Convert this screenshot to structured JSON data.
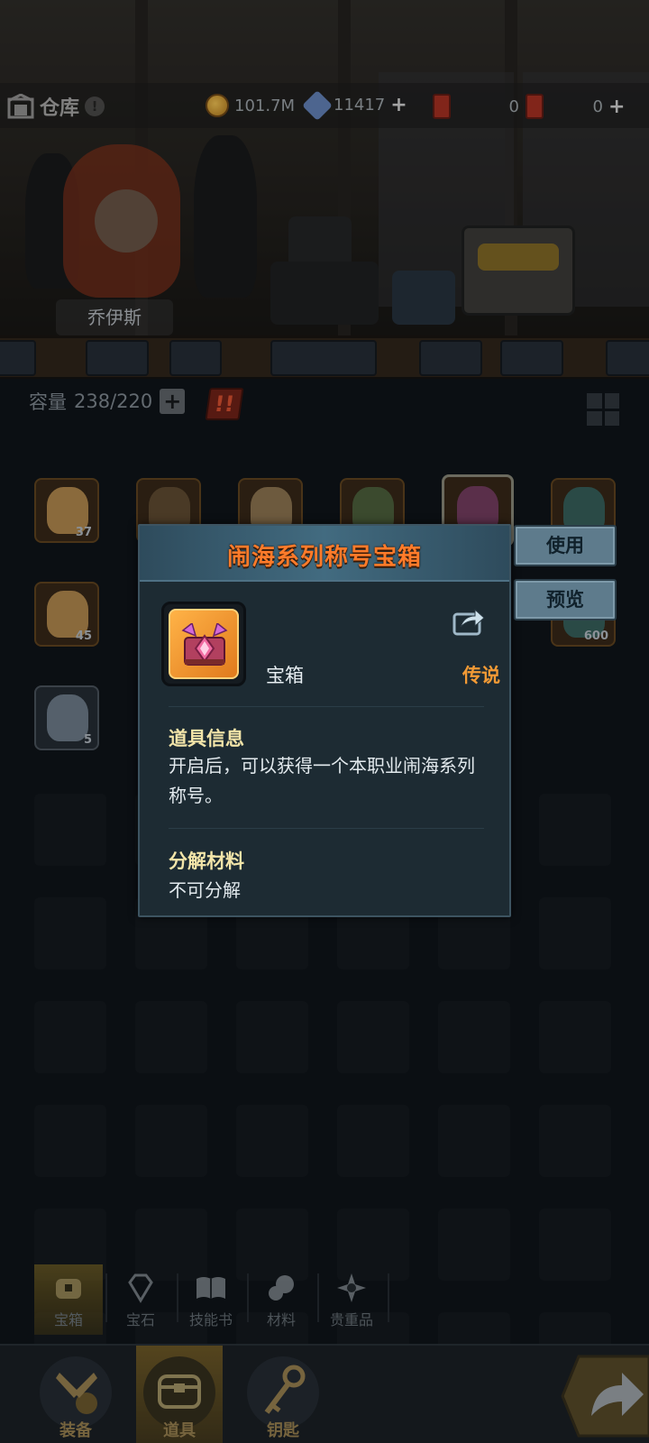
{
  "header": {
    "title": "仓库",
    "gold": "101.7M",
    "crystals": "11417",
    "ticket_a": "0",
    "ticket_b": "0"
  },
  "npc": {
    "name": "乔伊斯"
  },
  "capacity": {
    "label": "容量",
    "value": "238/220"
  },
  "inventory": {
    "row1": [
      {
        "qty": "37",
        "kind": "bronze-urn"
      },
      {
        "qty": "",
        "kind": "armor-bundle"
      },
      {
        "qty": "",
        "kind": "pearl-chest"
      },
      {
        "qty": "",
        "kind": "green-chest"
      },
      {
        "qty": "",
        "kind": "title-chest",
        "selected": true
      },
      {
        "qty": "",
        "kind": "teal-chest"
      }
    ],
    "row2": [
      {
        "qty": "45",
        "kind": "bronze-urn"
      },
      {
        "qty": "600",
        "kind": "teal-chest"
      }
    ],
    "row3": [
      {
        "qty": "5",
        "kind": "steel-urn"
      }
    ]
  },
  "popup": {
    "title": "闹海系列称号宝箱",
    "type": "宝箱",
    "rarity": "传说",
    "info_title": "道具信息",
    "info_text": "开启后，可以获得一个本职业闹海系列称号。",
    "decompose_title": "分解材料",
    "decompose_text": "不可分解"
  },
  "actions": {
    "use": "使用",
    "preview": "预览"
  },
  "categories": [
    {
      "label": "宝箱",
      "icon": "chest-icon",
      "active": true
    },
    {
      "label": "宝石",
      "icon": "gem-icon",
      "active": false
    },
    {
      "label": "技能书",
      "icon": "book-icon",
      "active": false
    },
    {
      "label": "材料",
      "icon": "material-icon",
      "active": false
    },
    {
      "label": "贵重品",
      "icon": "valuables-icon",
      "active": false
    }
  ],
  "nav": [
    {
      "label": "装备",
      "icon": "equipment-icon",
      "active": false
    },
    {
      "label": "道具",
      "icon": "items-icon",
      "active": true
    },
    {
      "label": "钥匙",
      "icon": "key-icon",
      "active": false
    }
  ],
  "colors": {
    "title_orange": "#ff7b2a",
    "legend_orange": "#f29a35",
    "section_yellow": "#f3e5a9",
    "button_blue": "#5e7b8c"
  }
}
